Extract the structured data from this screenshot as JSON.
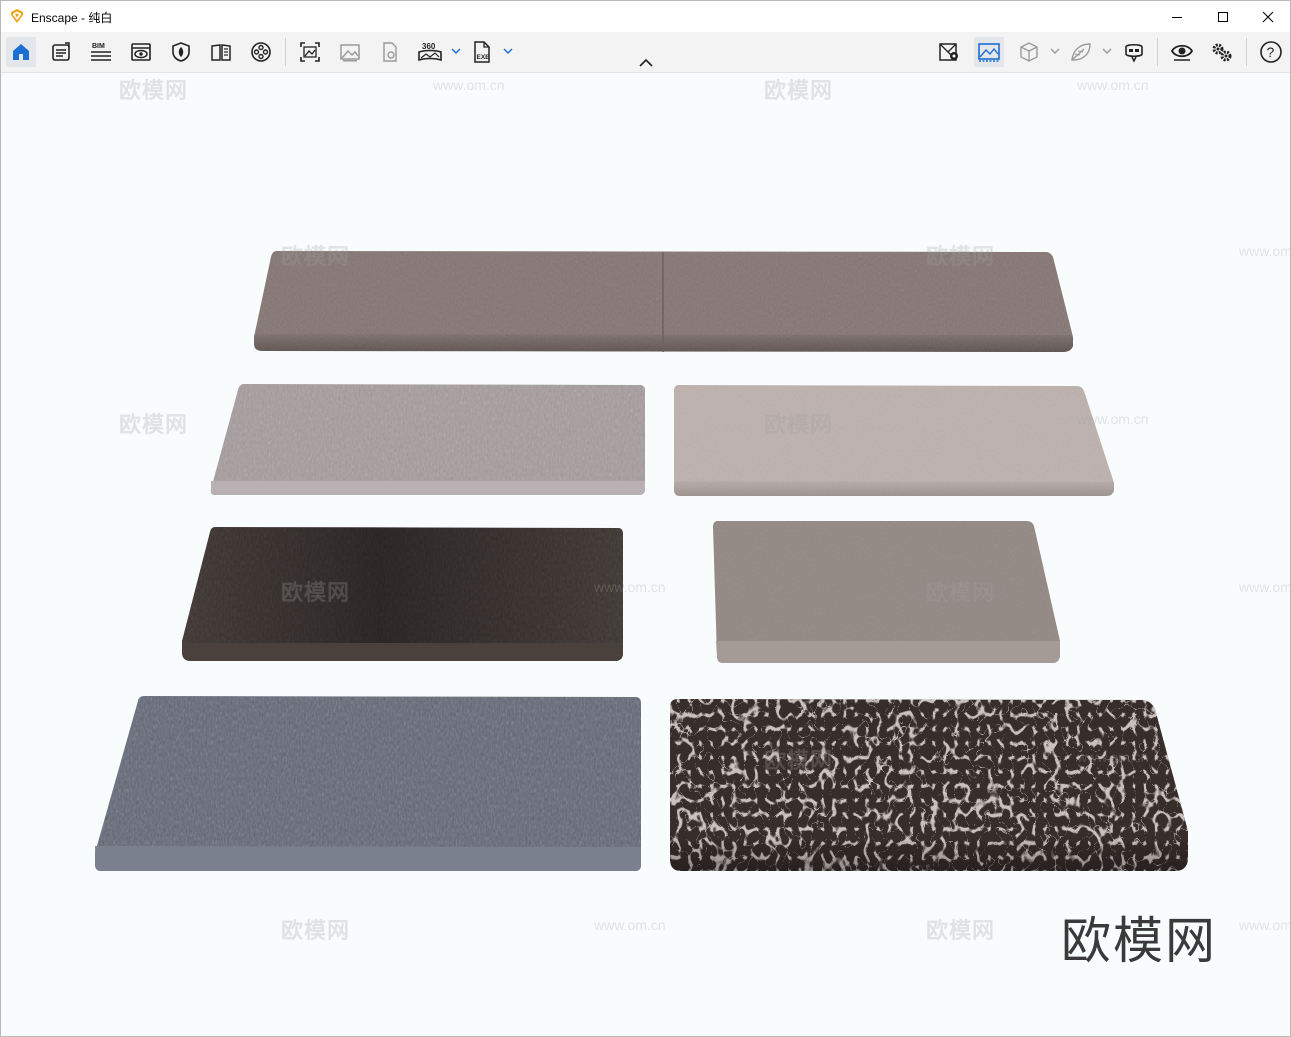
{
  "window": {
    "title": "Enscape - 纯白"
  },
  "toolbar": {
    "left_tools": [
      {
        "name": "home",
        "icon": "home-icon",
        "active": true
      },
      {
        "name": "info",
        "icon": "clipboard-icon"
      },
      {
        "name": "bim",
        "icon": "bim-icon",
        "label": "BIM"
      },
      {
        "name": "views",
        "icon": "eye-frame-icon"
      },
      {
        "name": "asset-library",
        "icon": "shield-leaf-icon"
      },
      {
        "name": "material-editor",
        "icon": "book-icon"
      },
      {
        "name": "video-editor",
        "icon": "film-reel-icon"
      }
    ],
    "capture_tools": [
      {
        "name": "screenshot",
        "icon": "screenshot-icon"
      },
      {
        "name": "batch-render",
        "icon": "image-icon"
      },
      {
        "name": "export-file",
        "icon": "file-gear-icon"
      },
      {
        "name": "panorama",
        "icon": "panorama-360-icon",
        "label": "360"
      },
      {
        "name": "export-exe",
        "icon": "exe-file-icon",
        "label": "EXE"
      }
    ],
    "right_tools": [
      {
        "name": "collaborative-annotation",
        "icon": "map-pin-icon"
      },
      {
        "name": "sync-views",
        "icon": "landscape-icon",
        "active": true
      },
      {
        "name": "orthographic",
        "icon": "cube-icon"
      },
      {
        "name": "materials",
        "icon": "leaf-icon"
      },
      {
        "name": "vr-headset",
        "icon": "vr-headset-icon"
      },
      {
        "name": "visual-settings",
        "icon": "eye-icon"
      },
      {
        "name": "general-settings",
        "icon": "gears-icon"
      },
      {
        "name": "help",
        "icon": "help-icon",
        "label": "?"
      }
    ]
  },
  "viewport": {
    "background": "#f9fcfd",
    "watermark_text": "欧模网",
    "watermark_url": "www.om.cn",
    "brand_logo": "欧模网",
    "cushions": [
      {
        "name": "long-taupe-cushion",
        "color": "#847572"
      },
      {
        "name": "light-gray-fabric-cushion",
        "color": "#a49a9c"
      },
      {
        "name": "beige-linen-cushion",
        "color": "#bdb1ad"
      },
      {
        "name": "dark-leather-cushion",
        "color": "#3d3532"
      },
      {
        "name": "taupe-velvet-cushion",
        "color": "#928883"
      },
      {
        "name": "blue-gray-melange-cushion",
        "color": "#5e6573"
      },
      {
        "name": "croc-leather-cushion",
        "color": "#372d2b"
      }
    ]
  }
}
